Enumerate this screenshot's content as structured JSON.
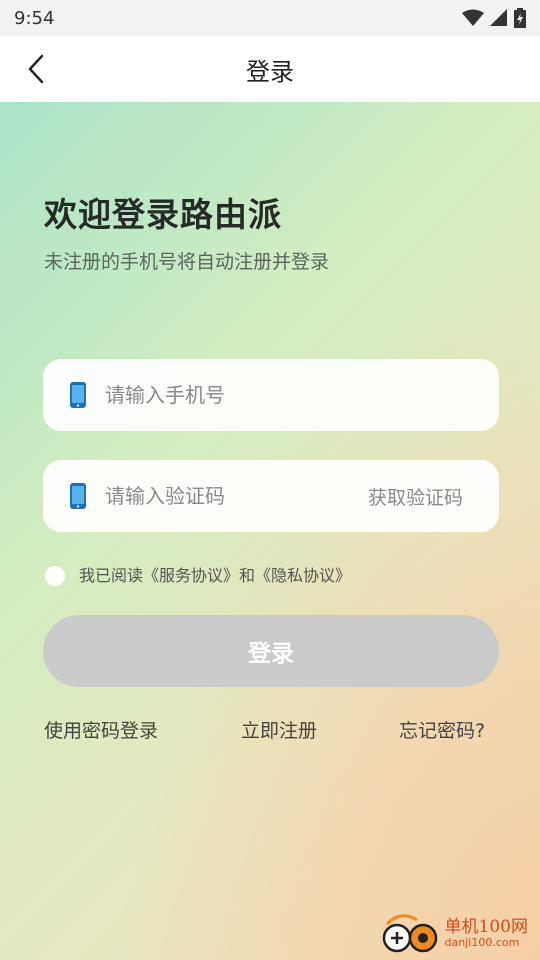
{
  "status_bar": {
    "time": "9:54"
  },
  "header": {
    "title": "登录"
  },
  "welcome": {
    "title": "欢迎登录路由派",
    "subtitle": "未注册的手机号将自动注册并登录"
  },
  "form": {
    "phone_placeholder": "请输入手机号",
    "code_placeholder": "请输入验证码",
    "get_code_label": "获取验证码",
    "agreement_text": "我已阅读《服务协议》和《隐私协议》",
    "login_label": "登录"
  },
  "links": {
    "password_login": "使用密码登录",
    "register": "立即注册",
    "forgot": "忘记密码?"
  },
  "watermark": {
    "text_cn": "单机100网",
    "text_en": "danji100.com"
  },
  "colors": {
    "login_button": "#cacaca",
    "gradient_start": "#a8e3c8",
    "gradient_end": "#f7cfa6",
    "phone_icon": "#2a8fd6"
  }
}
